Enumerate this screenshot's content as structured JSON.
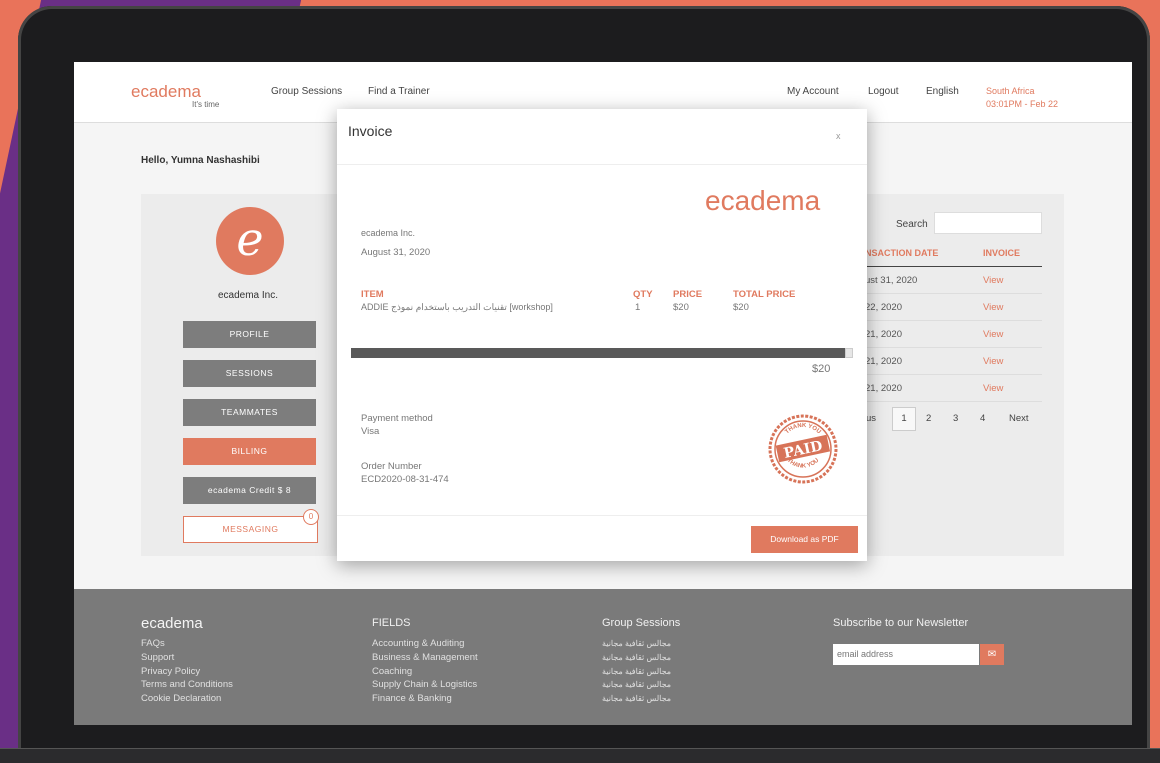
{
  "header": {
    "logo": "ecadema",
    "tagline": "It's time",
    "nav": [
      "Group Sessions",
      "Find a Trainer"
    ],
    "right_nav": [
      "My Account",
      "Logout",
      "English"
    ],
    "region_line1": "South Africa",
    "region_line2": "03:01PM - Feb 22"
  },
  "greeting": "Hello, Yumna Nashashibi",
  "profile": {
    "avatar_letter": "e",
    "name": "ecadema Inc.",
    "buttons": [
      "PROFILE",
      "SESSIONS",
      "TEAMMATES",
      "BILLING",
      "ecadema Credit   $ 8",
      "MESSAGING"
    ],
    "message_badge": "0"
  },
  "billing_table": {
    "search_label": "Search",
    "col_date": "NSACTION DATE",
    "col_invoice": "INVOICE",
    "rows": [
      {
        "date": "ust 31, 2020",
        "action": "View"
      },
      {
        "date": "22, 2020",
        "action": "View"
      },
      {
        "date": "21, 2020",
        "action": "View"
      },
      {
        "date": "21, 2020",
        "action": "View"
      },
      {
        "date": "21, 2020",
        "action": "View"
      }
    ],
    "pager": {
      "prev": "us",
      "pages": [
        "1",
        "2",
        "3",
        "4"
      ],
      "next": "Next"
    }
  },
  "invoice": {
    "title": "Invoice",
    "close": "x",
    "brand": "ecadema",
    "company": "ecadema Inc.",
    "date": "August 31, 2020",
    "col_item": "ITEM",
    "col_qty": "QTY",
    "col_price": "PRICE",
    "col_total": "TOTAL PRICE",
    "item_name": "ADDIE تقنيات التدريب باستخدام نموذج [workshop]",
    "qty": "1",
    "price": "$20",
    "total_price": "$20",
    "grand_total": "$20",
    "payment_label": "Payment method",
    "payment_value": "Visa",
    "order_label": "Order Number",
    "order_value": "ECD2020-08-31-474",
    "stamp_main": "PAID",
    "stamp_top": "THANK YOU",
    "stamp_bottom": "THANK YOU",
    "download_button": "Download as PDF"
  },
  "footer": {
    "logo": "ecadema",
    "links_col1": [
      "FAQs",
      "Support",
      "Privacy Policy",
      "Terms and Conditions",
      "Cookie Declaration"
    ],
    "fields_head": "FIELDS",
    "fields": [
      "Accounting & Auditing",
      "Business & Management",
      "Coaching",
      "Supply Chain & Logistics",
      "Finance & Banking"
    ],
    "group_head": "Group Sessions",
    "group_items": [
      "مجالس ثقافية مجانية",
      "مجالس ثقافية مجانية",
      "مجالس ثقافية مجانية",
      "مجالس ثقافية مجانية",
      "مجالس ثقافية مجانية"
    ],
    "newsletter_head": "Subscribe to our Newsletter",
    "newsletter_placeholder": "email address",
    "newsletter_icon": "mail-icon"
  },
  "colors": {
    "accent": "#e07a5f",
    "button_gray": "#7d7d7d",
    "footer": "#7a7a7a",
    "purple": "#6a2f86"
  }
}
